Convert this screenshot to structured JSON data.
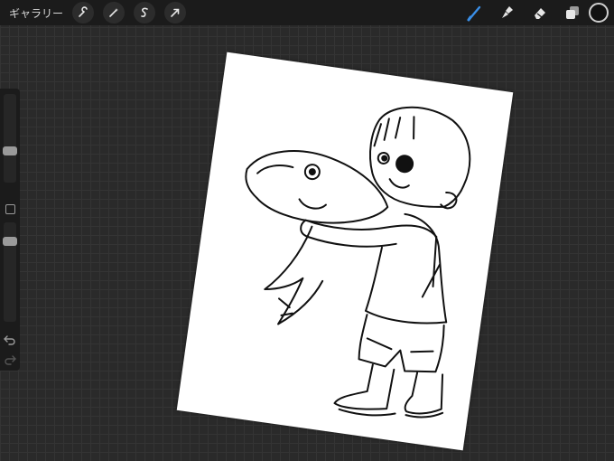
{
  "topbar": {
    "gallery_label": "ギャラリー",
    "left_tools": [
      "wrench-icon",
      "magic-wand-icon",
      "selection-icon",
      "transform-arrow-icon"
    ],
    "right_tools": [
      "brush-icon",
      "smudge-icon",
      "eraser-icon",
      "layers-icon"
    ],
    "active_tool": "brush-icon",
    "accent_color": "#3a8ee6",
    "current_color": "#111111"
  },
  "sidebar": {
    "brush_size_level": 0.34,
    "opacity_level": 0.84,
    "modify_button": "square-icon",
    "undo": "undo-icon",
    "redo": "redo-icon"
  },
  "canvas": {
    "background": "#ffffff",
    "subject": "sketch-boy-holding-fish"
  }
}
